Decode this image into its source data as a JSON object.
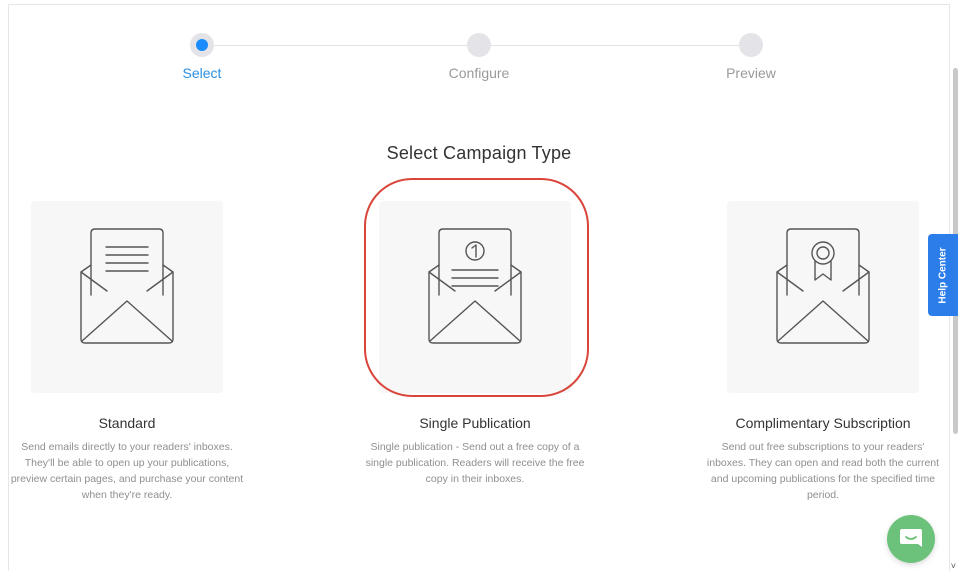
{
  "stepper": {
    "steps": [
      {
        "label": "Select",
        "active": true
      },
      {
        "label": "Configure",
        "active": false
      },
      {
        "label": "Preview",
        "active": false
      }
    ]
  },
  "section_title": "Select Campaign Type",
  "cards": [
    {
      "title": "Standard",
      "description": "Send emails directly to your readers' inboxes. They'll be able to open up your publications, preview certain pages, and purchase your content when they're ready.",
      "icon": "envelope-document-icon"
    },
    {
      "title": "Single Publication",
      "description": "Single publication - Send out a free copy of a single publication. Readers will receive the free copy in their inboxes.",
      "icon": "envelope-number-one-icon"
    },
    {
      "title": "Complimentary Subscription",
      "description": "Send out free subscriptions to your readers' inboxes. They can open and read both the current and upcoming publications for the specified time period.",
      "icon": "envelope-ribbon-icon"
    }
  ],
  "help_center": {
    "label": "Help Center"
  },
  "chat": {
    "icon": "chat-icon"
  },
  "colors": {
    "accent": "#1a8cff",
    "highlight": "#d9453b",
    "help_tab": "#2b7de9",
    "chat": "#6cc27a"
  }
}
